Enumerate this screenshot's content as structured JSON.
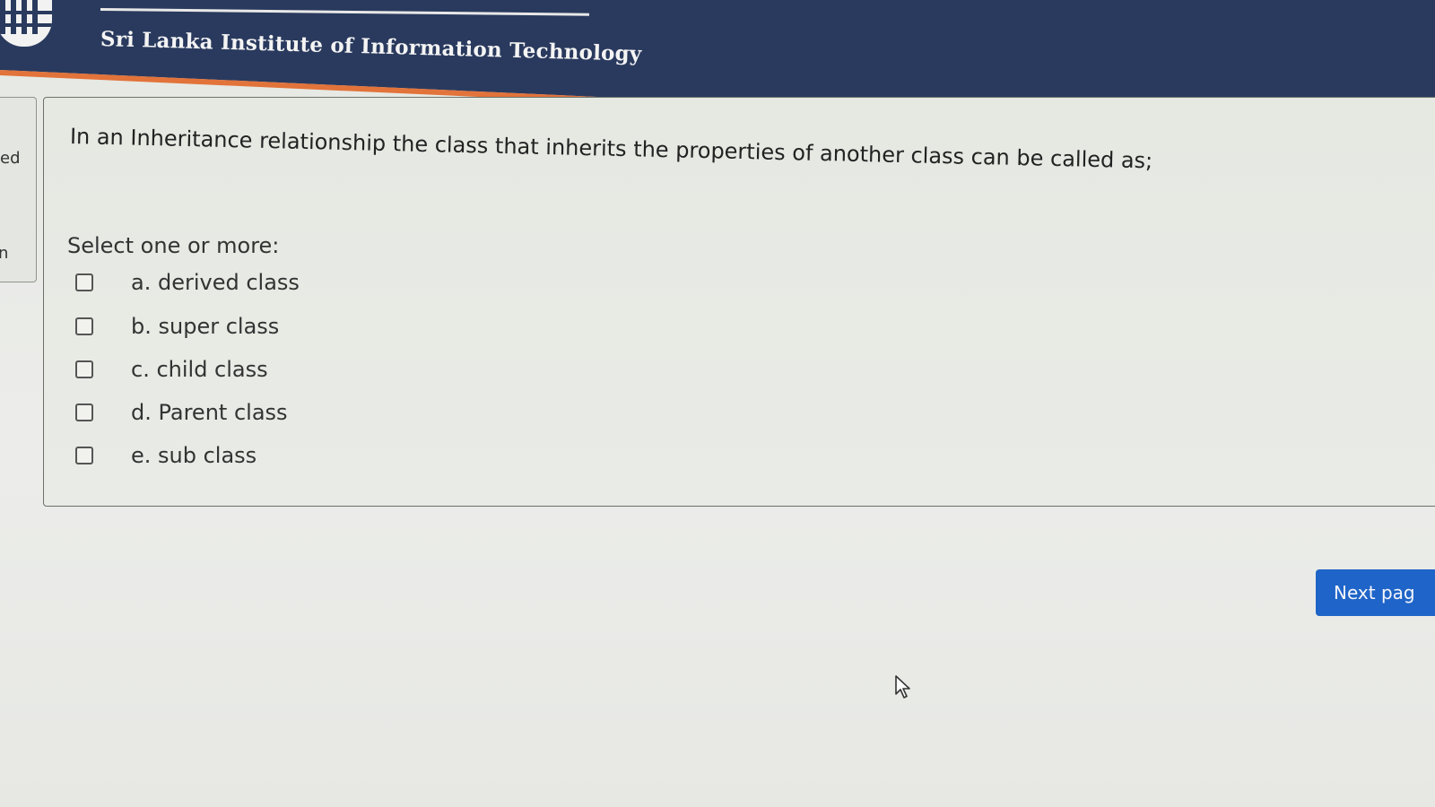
{
  "header": {
    "institute_name": "Sri Lanka Institute of Information Technology",
    "colors": {
      "background": "#2a3a5e",
      "accent": "#e2733a"
    }
  },
  "left_panel": {
    "partial_text_1": "ed",
    "partial_text_2": "n"
  },
  "question": {
    "text": "In an Inheritance relationship the class that inherits the properties of another class can be called as;",
    "instruction": "Select one or more:",
    "options": [
      {
        "label": "a. derived class",
        "checked": false
      },
      {
        "label": "b. super class",
        "checked": false
      },
      {
        "label": "c. child class",
        "checked": false
      },
      {
        "label": "d. Parent class",
        "checked": false
      },
      {
        "label": "e. sub class",
        "checked": false
      }
    ]
  },
  "navigation": {
    "next_label": "Next pag",
    "button_color": "#1f64c8"
  },
  "icons": {
    "logo": "institute-logo-icon",
    "cursor": "mouse-pointer-icon"
  }
}
